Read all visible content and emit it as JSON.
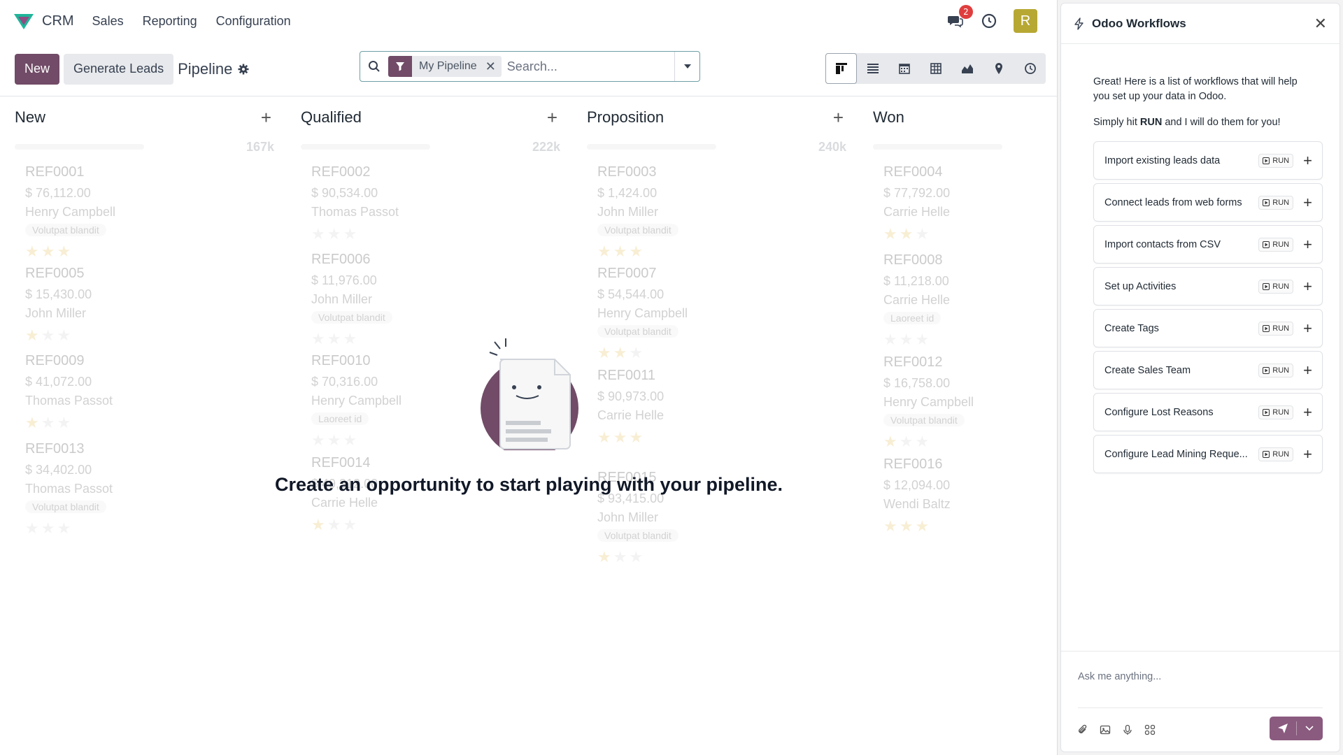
{
  "navbar": {
    "app_name": "CRM",
    "menu": [
      "Sales",
      "Reporting",
      "Configuration"
    ],
    "messages_badge": "2",
    "avatar_letter": "R",
    "brand_color": "#714b67",
    "avatar_color": "#b7a833"
  },
  "control_panel": {
    "new_label": "New",
    "generate_label": "Generate Leads",
    "breadcrumb": "Pipeline",
    "search": {
      "facet_label": "My Pipeline",
      "placeholder": "Search..."
    },
    "views": [
      "kanban-icon",
      "list-icon",
      "calendar-icon",
      "pivot-icon",
      "graph-icon",
      "map-icon",
      "activity-icon"
    ],
    "active_view": "kanban-icon"
  },
  "kanban": {
    "columns": [
      {
        "title": "New",
        "total": "167k",
        "cards": [
          {
            "ref": "REF0001",
            "amount": "$ 76,112.00",
            "person": "Henry Campbell",
            "tag": "Volutpat blandit",
            "stars": 3
          },
          {
            "ref": "REF0005",
            "amount": "$ 15,430.00",
            "person": "John Miller",
            "tag": "",
            "stars": 1
          },
          {
            "ref": "REF0009",
            "amount": "$ 41,072.00",
            "person": "Thomas Passot",
            "tag": "",
            "stars": 1
          },
          {
            "ref": "REF0013",
            "amount": "$ 34,402.00",
            "person": "Thomas Passot",
            "tag": "Volutpat blandit",
            "stars": 0
          }
        ]
      },
      {
        "title": "Qualified",
        "total": "222k",
        "cards": [
          {
            "ref": "REF0002",
            "amount": "$ 90,534.00",
            "person": "Thomas Passot",
            "tag": "",
            "stars": 0
          },
          {
            "ref": "REF0006",
            "amount": "$ 11,976.00",
            "person": "John Miller",
            "tag": "Volutpat blandit",
            "stars": 0
          },
          {
            "ref": "REF0010",
            "amount": "$ 70,316.00",
            "person": "Henry Campbell",
            "tag": "Laoreet id",
            "stars": 0
          },
          {
            "ref": "REF0014",
            "amount": "$ 49,312.00",
            "person": "Carrie Helle",
            "tag": "",
            "stars": 1
          }
        ]
      },
      {
        "title": "Proposition",
        "total": "240k",
        "cards": [
          {
            "ref": "REF0003",
            "amount": "$ 1,424.00",
            "person": "John Miller",
            "tag": "Volutpat blandit",
            "stars": 3
          },
          {
            "ref": "REF0007",
            "amount": "$ 54,544.00",
            "person": "Henry Campbell",
            "tag": "Volutpat blandit",
            "stars": 2
          },
          {
            "ref": "REF0011",
            "amount": "$ 90,973.00",
            "person": "Carrie Helle",
            "tag": "",
            "stars": 3
          },
          {
            "ref": "REF0015",
            "amount": "$ 93,415.00",
            "person": "John Miller",
            "tag": "Volutpat blandit",
            "stars": 1
          }
        ]
      },
      {
        "title": "Won",
        "total": "",
        "cards": [
          {
            "ref": "REF0004",
            "amount": "$ 77,792.00",
            "person": "Carrie Helle",
            "tag": "",
            "stars": 2
          },
          {
            "ref": "REF0008",
            "amount": "$ 11,218.00",
            "person": "Carrie Helle",
            "tag": "Laoreet id",
            "stars": 0
          },
          {
            "ref": "REF0012",
            "amount": "$ 16,758.00",
            "person": "Henry Campbell",
            "tag": "Volutpat blandit",
            "stars": 1
          },
          {
            "ref": "REF0016",
            "amount": "$ 12,094.00",
            "person": "Wendi Baltz",
            "tag": "",
            "stars": 3
          }
        ]
      }
    ],
    "empty_message": "Create an opportunity to start playing with your pipeline."
  },
  "workflows": {
    "title": "Odoo Workflows",
    "intro_1": "Great! Here is a list of workflows that will help you set up your data in Odoo.",
    "intro_2_pre": "Simply hit ",
    "intro_2_bold": "RUN",
    "intro_2_post": " and I will do them for you!",
    "run_label": "RUN",
    "items": [
      "Import existing leads data",
      "Connect leads from web forms",
      "Import contacts from CSV",
      "Set up Activities",
      "Create Tags",
      "Create Sales Team",
      "Configure Lost Reasons",
      "Configure Lead Mining Reque..."
    ],
    "chat_placeholder": "Ask me anything...",
    "send_color": "#8a5a7f"
  }
}
